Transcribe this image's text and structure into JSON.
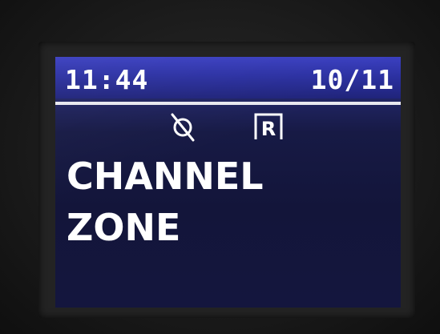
{
  "status_bar": {
    "time": "11:44",
    "date": "10/11"
  },
  "icons": {
    "left": "no-alert-icon",
    "right": "repeater-r-icon",
    "right_letter": "R"
  },
  "display": {
    "line1": "CHANNEL",
    "line2": "ZONE"
  },
  "colors": {
    "screen_background": "#171a45",
    "status_bar": "#2c31a3",
    "text": "#ffffff"
  }
}
